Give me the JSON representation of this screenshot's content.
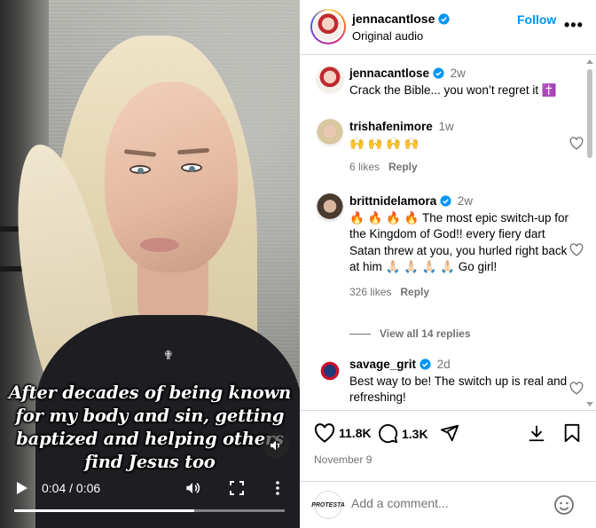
{
  "video": {
    "caption_lines": [
      "After decades of being known",
      "for my body and sin, getting",
      "baptized and helping others",
      "find Jesus too"
    ],
    "time_display": "0:04 / 0:06",
    "progress": 0.667
  },
  "header": {
    "username": "jennacantlose",
    "subtitle": "Original audio",
    "follow_label": "Follow",
    "more_label": "•••"
  },
  "comments": [
    {
      "username": "jennacantlose",
      "time": "2w",
      "verified": true,
      "text": "Crack the Bible... you won’t regret it ✝️"
    },
    {
      "username": "trishafenimore",
      "time": "1w",
      "verified": false,
      "text": "🙌 🙌 🙌 🙌",
      "likes": "6 likes",
      "reply": "Reply"
    },
    {
      "username": "brittnidelamora",
      "time": "2w",
      "verified": true,
      "text": "🔥 🔥 🔥 🔥  The most epic switch-up for the Kingdom of God!! every fiery dart Satan threw at you, you hurled right back at him 🙏🏻 🙏🏻 🙏🏻 🙏🏻  Go girl!",
      "likes": "326 likes",
      "reply": "Reply",
      "view_replies": "View all 14 replies"
    },
    {
      "username": "savage_grit",
      "time": "2d",
      "verified": true,
      "text": "Best way to be! The switch up is real and refreshing!"
    }
  ],
  "actions": {
    "likes": "11.8K",
    "comments": "1.3K",
    "date": "November 9"
  },
  "add_comment": {
    "avatar_text": "PROTESTA",
    "placeholder": "Add a comment..."
  },
  "colors": {
    "link_blue": "#0095f6",
    "verified_blue": "#0095f6",
    "muted_text": "#737373",
    "divider": "#dbdbdb"
  },
  "icons": [
    "play-icon",
    "volume-icon",
    "fullscreen-icon",
    "kebab-icon",
    "mute-icon",
    "heart-icon",
    "comment-icon",
    "share-icon",
    "download-icon",
    "bookmark-icon",
    "emoji-icon",
    "verified-icon"
  ]
}
